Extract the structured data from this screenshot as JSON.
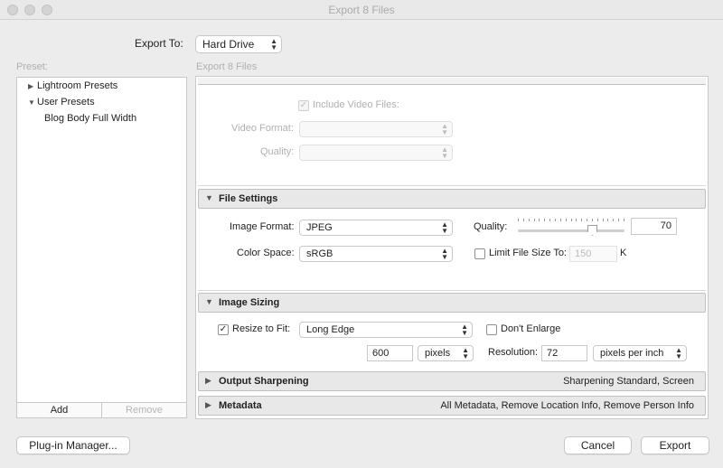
{
  "window": {
    "title": "Export 8 Files"
  },
  "export_to": {
    "label": "Export To:",
    "value": "Hard Drive"
  },
  "preset": {
    "label": "Preset:",
    "items": [
      {
        "label": "Lightroom Presets",
        "expanded": false
      },
      {
        "label": "User Presets",
        "expanded": true
      },
      {
        "label": "Blog Body Full Width"
      }
    ],
    "add_label": "Add",
    "remove_label": "Remove"
  },
  "panel_caption": "Export 8 Files",
  "video": {
    "include_label": "Include Video Files:",
    "include_checked": true,
    "format_label": "Video Format:",
    "format_value": "",
    "quality_label": "Quality:",
    "quality_value": ""
  },
  "file_settings": {
    "header": "File Settings",
    "image_format_label": "Image Format:",
    "image_format_value": "JPEG",
    "quality_label": "Quality:",
    "quality_value": "70",
    "quality_level": 0.7,
    "color_space_label": "Color Space:",
    "color_space_value": "sRGB",
    "limit_label": "Limit File Size To:",
    "limit_checked": false,
    "limit_value": "150",
    "limit_unit": "K"
  },
  "image_sizing": {
    "header": "Image Sizing",
    "resize_label": "Resize to Fit:",
    "resize_checked": true,
    "resize_value": "Long Edge",
    "dont_enlarge_label": "Don't Enlarge",
    "dont_enlarge_checked": false,
    "size_value": "600",
    "size_unit": "pixels",
    "resolution_label": "Resolution:",
    "resolution_value": "72",
    "resolution_unit": "pixels per inch"
  },
  "output_sharpening": {
    "header": "Output Sharpening",
    "summary": "Sharpening Standard, Screen"
  },
  "metadata": {
    "header": "Metadata",
    "summary": "All Metadata, Remove Location Info, Remove Person Info"
  },
  "buttons": {
    "plugin_manager": "Plug-in Manager...",
    "cancel": "Cancel",
    "export": "Export"
  },
  "icons": {
    "checkmark": "✓",
    "expanded_triangle": "▼",
    "collapsed_triangle": "▶",
    "popup_arrows": "⌃⌄"
  }
}
